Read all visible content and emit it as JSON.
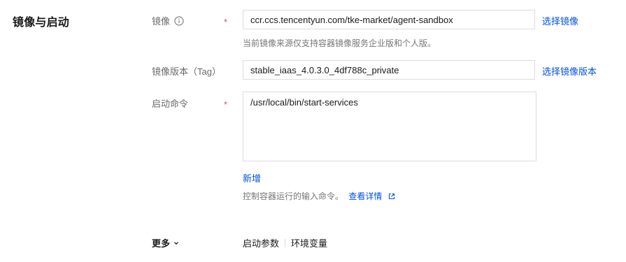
{
  "section": {
    "title": "镜像与启动"
  },
  "image": {
    "label": "镜像",
    "required_mark": "*",
    "value": "ccr.ccs.tencentyun.com/tke-market/agent-sandbox",
    "select_link": "选择镜像",
    "help": "当前镜像来源仅支持容器镜像服务企业版和个人版。"
  },
  "tag": {
    "label": "镜像版本（Tag）",
    "value": "stable_iaas_4.0.3.0_4df788c_private",
    "select_link": "选择镜像版本"
  },
  "command": {
    "label": "启动命令",
    "required_mark": "*",
    "value": "/usr/local/bin/start-services",
    "add_link": "新增",
    "help": "控制容器运行的输入命令。",
    "details_link": "查看详情"
  },
  "more": {
    "label": "更多",
    "items": [
      "启动参数",
      "环境变量"
    ]
  },
  "icons": {
    "info": "info-circle-icon",
    "external": "external-link-icon",
    "chevron": "chevron-down-icon"
  },
  "colors": {
    "link": "#0052d9",
    "required": "#e34d59",
    "border": "#dcdcdc"
  }
}
